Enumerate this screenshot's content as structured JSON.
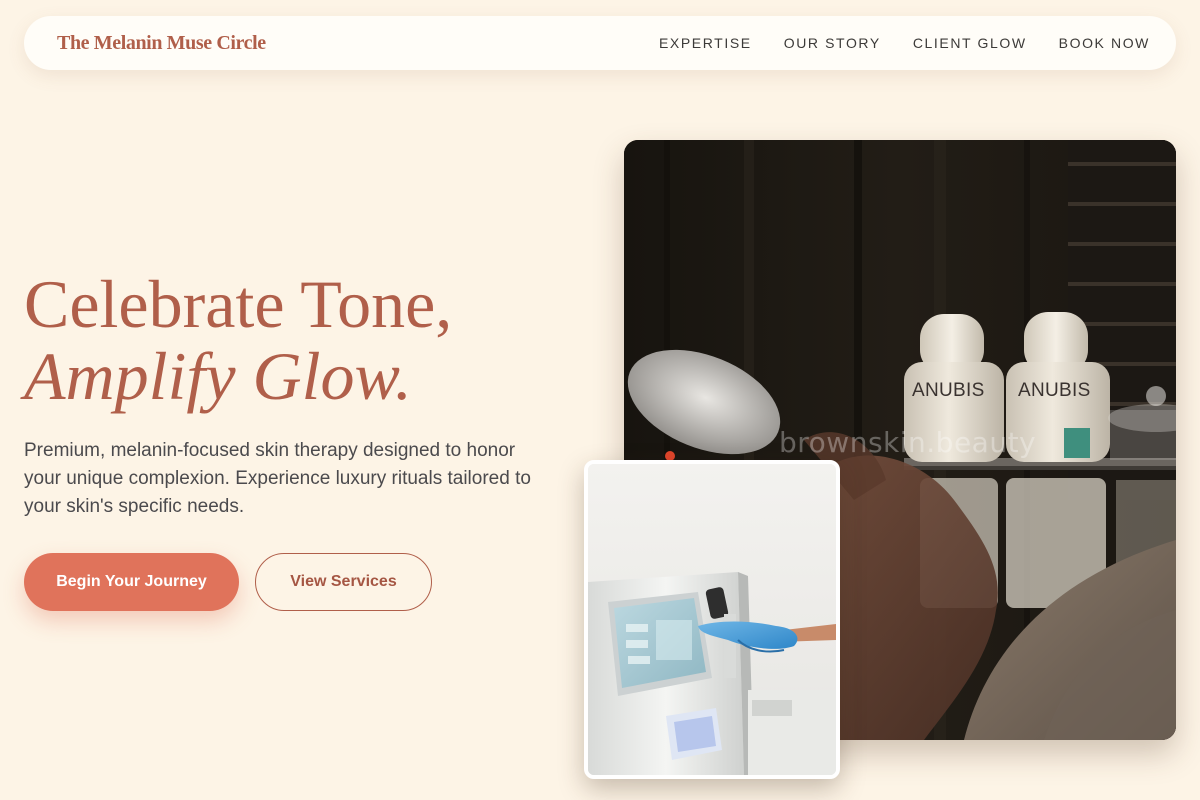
{
  "brand": {
    "name": "The Melanin Muse Circle"
  },
  "nav": {
    "items": [
      {
        "label": "EXPERTISE"
      },
      {
        "label": "OUR STORY"
      },
      {
        "label": "CLIENT GLOW"
      },
      {
        "label": "BOOK NOW"
      }
    ]
  },
  "hero": {
    "title_line1": "Celebrate Tone,",
    "title_line2": "Amplify Glow.",
    "description": "Premium, melanin-focused skin therapy designed to honor your unique complexion. Experience luxury rituals tailored to your skin's specific needs.",
    "primary_cta": "Begin Your Journey",
    "secondary_cta": "View Services"
  },
  "media": {
    "main_photo": {
      "watermark": "brownskin.beauty",
      "bottle_label_1": "ANUBIS",
      "bottle_label_2": "ANUBIS"
    }
  },
  "colors": {
    "background": "#fdf4e6",
    "brand": "#b05f4a",
    "accent": "#e0735b",
    "nav_background": "#fffdf8",
    "body_text": "#4b4a4d"
  }
}
